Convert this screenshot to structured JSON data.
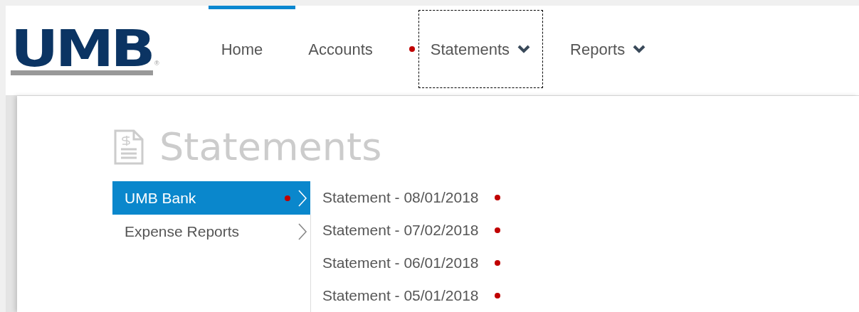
{
  "logo": {
    "text": "UMB",
    "mark": "®"
  },
  "nav": [
    {
      "label": "Home",
      "selected": true,
      "focused": false,
      "marked": false,
      "has_menu": false
    },
    {
      "label": "Accounts",
      "selected": false,
      "focused": false,
      "marked": false,
      "has_menu": false
    },
    {
      "label": "Statements",
      "selected": false,
      "focused": true,
      "marked": true,
      "has_menu": true
    },
    {
      "label": "Reports",
      "selected": false,
      "focused": false,
      "marked": false,
      "has_menu": true
    }
  ],
  "page": {
    "title": "Statements"
  },
  "sidebar": {
    "items": [
      {
        "label": "UMB Bank",
        "selected": true,
        "marked": true
      },
      {
        "label": "Expense Reports",
        "selected": false,
        "marked": false
      }
    ]
  },
  "statements": [
    {
      "label": "Statement - 08/01/2018",
      "marked": true
    },
    {
      "label": "Statement - 07/02/2018",
      "marked": true
    },
    {
      "label": "Statement - 06/01/2018",
      "marked": true
    },
    {
      "label": "Statement - 05/01/2018",
      "marked": true
    }
  ]
}
